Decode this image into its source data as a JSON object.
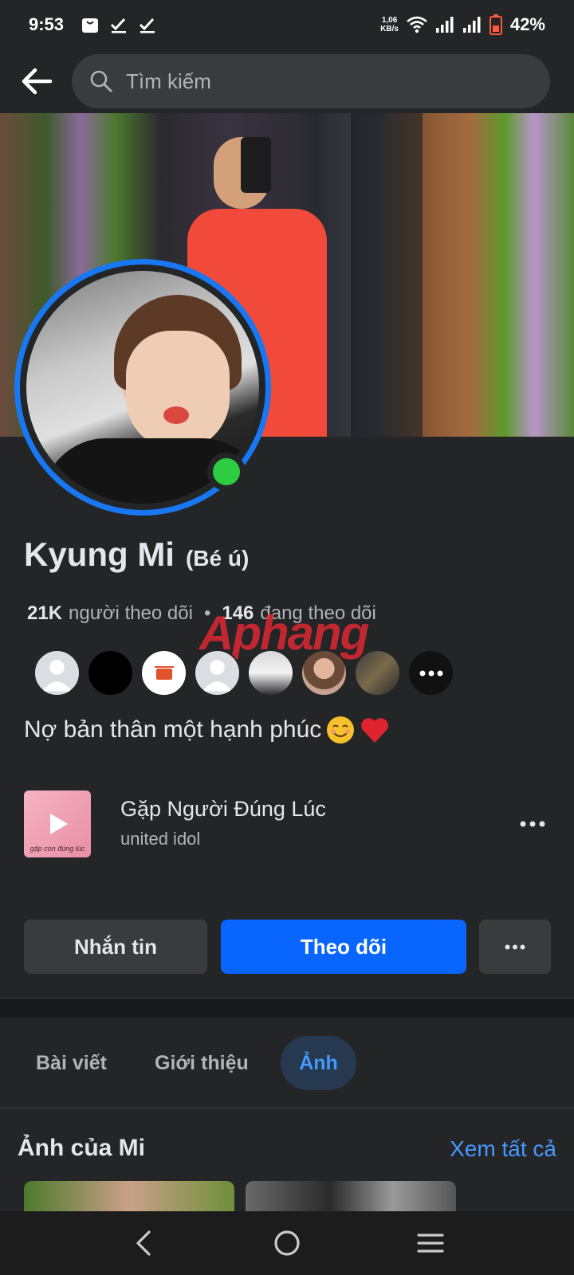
{
  "status_bar": {
    "time": "9:53",
    "net_speed_value": "1,06",
    "net_speed_unit": "KB/s",
    "battery": "42%"
  },
  "header": {
    "search_placeholder": "Tìm kiếm"
  },
  "profile": {
    "name": "Kyung Mi",
    "nickname": "(Bé ú)",
    "followers_count": "21K",
    "followers_label": "người theo dõi",
    "following_count": "146",
    "following_label": "đang theo dõi",
    "bio": "Nợ bản thân một hạnh phúc",
    "online": true
  },
  "watermark": {
    "part1": "Aphang",
    "part2": ""
  },
  "music": {
    "title": "Gặp Người Đúng Lúc",
    "artist": "united idol",
    "thumb_caption": "gặp con đúng lúc"
  },
  "actions": {
    "message": "Nhắn tin",
    "follow": "Theo dõi",
    "more": "•••"
  },
  "tabs": [
    {
      "label": "Bài viết",
      "active": false
    },
    {
      "label": "Giới thiệu",
      "active": false
    },
    {
      "label": "Ảnh",
      "active": true
    }
  ],
  "photos_section": {
    "title": "Ảnh của Mi",
    "see_all": "Xem tất cả"
  },
  "colors": {
    "background": "#242526",
    "primary": "#0866ff",
    "online": "#2ecc40",
    "link": "#4599ff"
  }
}
